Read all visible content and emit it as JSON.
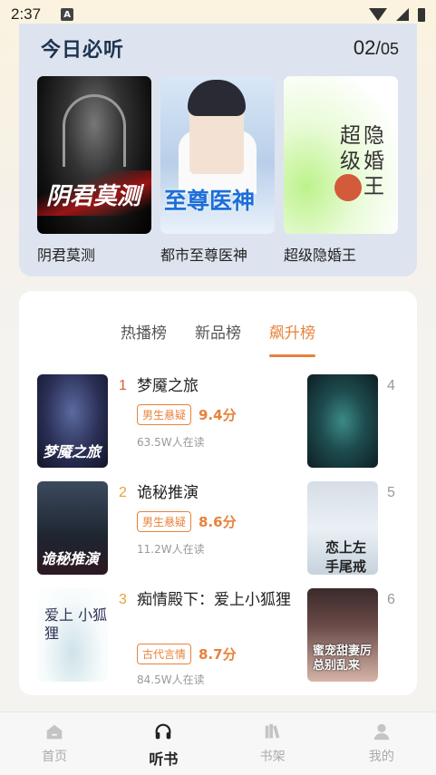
{
  "status_bar": {
    "time": "2:37",
    "notification_icon": "A",
    "icons": [
      "wifi-icon",
      "signal-icon",
      "battery-icon"
    ]
  },
  "today": {
    "title": "今日必听",
    "page_current": "02",
    "page_separator": "/",
    "page_total": "05",
    "books": [
      {
        "title": "阴君莫测",
        "cover_text": "阴君莫测"
      },
      {
        "title": "都市至尊医神",
        "cover_text": "至尊医神"
      },
      {
        "title": "超级隐婚王",
        "cover_col1": "超级",
        "cover_col2": "隐婚王"
      }
    ]
  },
  "ranking": {
    "tabs": [
      {
        "label": "热播榜",
        "active": false
      },
      {
        "label": "新品榜",
        "active": false
      },
      {
        "label": "飙升榜",
        "active": true
      }
    ],
    "items": [
      {
        "rank": "1",
        "title": "梦魇之旅",
        "tag": "男生悬疑",
        "score": "9.4分",
        "listeners": "63.5W人在读",
        "cover_text": "梦魇之旅"
      },
      {
        "rank": "2",
        "title": "诡秘推演",
        "tag": "男生悬疑",
        "score": "8.6分",
        "listeners": "11.2W人在读",
        "cover_text": "诡秘推演"
      },
      {
        "rank": "3",
        "title": "痴情殿下：爱上小狐狸",
        "tag": "古代言情",
        "score": "8.7分",
        "listeners": "84.5W人在读",
        "cover_text": "爱上 小狐狸"
      },
      {
        "rank": "4"
      },
      {
        "rank": "5",
        "cover_text": "恋上左手尾戒"
      },
      {
        "rank": "6",
        "cover_text": "蜜宠甜妻厉总别乱来"
      }
    ],
    "colors": {
      "accent": "#e8823a",
      "rank_top": "#e05a3a",
      "rank_mid": "#e8a23a",
      "rank_other": "#999999"
    }
  },
  "bottom_nav": [
    {
      "label": "首页",
      "icon": "home-icon",
      "active": false
    },
    {
      "label": "听书",
      "icon": "headphones-icon",
      "active": true
    },
    {
      "label": "书架",
      "icon": "bookshelf-icon",
      "active": false
    },
    {
      "label": "我的",
      "icon": "user-icon",
      "active": false
    }
  ]
}
